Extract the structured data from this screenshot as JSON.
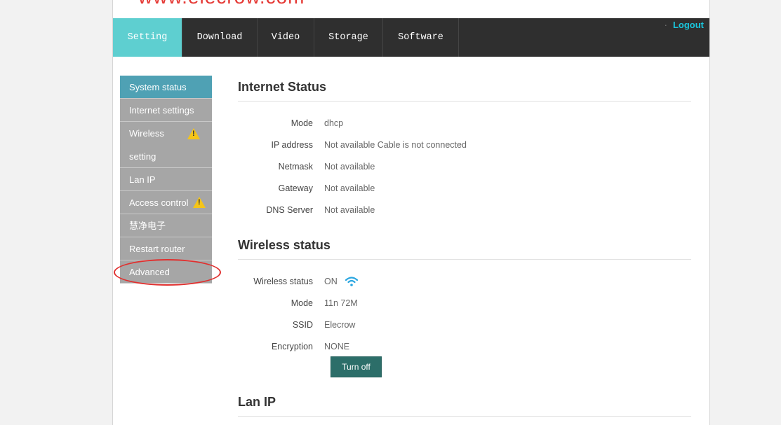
{
  "brand": "www.elecrow.com",
  "nav": {
    "tabs": [
      "Setting",
      "Download",
      "Video",
      "Storage",
      "Software"
    ],
    "logout": "Logout",
    "logout_dot": "·"
  },
  "sidebar": {
    "items": [
      {
        "label": "System status"
      },
      {
        "label": "Internet settings"
      },
      {
        "label": "Wireless"
      },
      {
        "label": "setting"
      },
      {
        "label": "Lan IP"
      },
      {
        "label": "Access control"
      },
      {
        "label": "慧净电子"
      },
      {
        "label": "Restart router"
      },
      {
        "label": "Advanced settings"
      }
    ],
    "warning_glyph": "!"
  },
  "internet_status": {
    "title": "Internet Status",
    "rows": [
      {
        "label": "Mode",
        "value": "dhcp"
      },
      {
        "label": "IP address",
        "value": "Not available Cable is not connected"
      },
      {
        "label": "Netmask",
        "value": "Not available"
      },
      {
        "label": "Gateway",
        "value": "Not available"
      },
      {
        "label": "DNS Server",
        "value": "Not available"
      }
    ]
  },
  "wireless_status": {
    "title": "Wireless status",
    "rows": [
      {
        "label": "Wireless status",
        "value": "ON"
      },
      {
        "label": "Mode",
        "value": "11n 72M"
      },
      {
        "label": "SSID",
        "value": "Elecrow"
      },
      {
        "label": "Encryption",
        "value": "NONE"
      }
    ],
    "turn_off_label": "Turn off"
  },
  "lan_ip": {
    "title": "Lan IP"
  },
  "colors": {
    "active_tab": "#5ecfd0",
    "active_sidebar": "#4fa1b4",
    "logout": "#19c6dd",
    "button": "#2c6e69",
    "highlight_circle": "#e0302f"
  }
}
